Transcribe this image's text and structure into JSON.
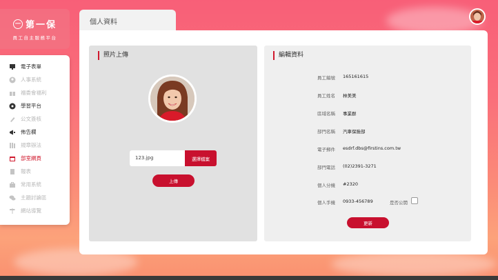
{
  "brand": {
    "logo_glyph": "一",
    "logo_text": "第一保",
    "subtitle": "員工自主服務平台"
  },
  "page_tab": "個人資料",
  "sidebar": {
    "items": [
      {
        "label": "電子表單",
        "icon": "monitor-icon",
        "state": "on"
      },
      {
        "label": "人事系統",
        "icon": "person-icon",
        "state": "off"
      },
      {
        "label": "福委會福利",
        "icon": "gift-icon",
        "state": "off"
      },
      {
        "label": "學習平台",
        "icon": "soccer-ball-icon",
        "state": "on"
      },
      {
        "label": "公文簽核",
        "icon": "pen-icon",
        "state": "off"
      },
      {
        "label": "佈告欄",
        "icon": "megaphone-icon",
        "state": "on"
      },
      {
        "label": "規章辦法",
        "icon": "books-icon",
        "state": "off"
      },
      {
        "label": "部室網頁",
        "icon": "calendar-icon",
        "state": "active"
      },
      {
        "label": "報表",
        "icon": "document-icon",
        "state": "off"
      },
      {
        "label": "常用系統",
        "icon": "briefcase-icon",
        "state": "off"
      },
      {
        "label": "主題討論區",
        "icon": "chat-icon",
        "state": "off"
      },
      {
        "label": "網站導覽",
        "icon": "signpost-icon",
        "state": "off"
      }
    ]
  },
  "photo_panel": {
    "title": "照片上傳",
    "file_name": "123.jpg",
    "choose_button": "選擇檔案",
    "upload_button": "上傳"
  },
  "edit_panel": {
    "title": "編輯資料",
    "fields": [
      {
        "label": "員工編號",
        "value": "165161615"
      },
      {
        "label": "員工姓名",
        "value": "林美美"
      },
      {
        "label": "區域名稱",
        "value": "事業群"
      },
      {
        "label": "部門名稱",
        "value": "汽車保險部"
      },
      {
        "label": "電子郵件",
        "value": "esdrf.dbs@firstins.com.tw"
      },
      {
        "label": "部門電話",
        "value": "(02)2391-3271"
      },
      {
        "label": "個人分機",
        "value": "#2320"
      },
      {
        "label": "個人手機",
        "value": "0933-456789"
      }
    ],
    "public_label": "是否公開",
    "public_checked": false,
    "update_button": "更新"
  },
  "colors": {
    "accent": "#c8102e",
    "active_text": "#d0182c"
  }
}
